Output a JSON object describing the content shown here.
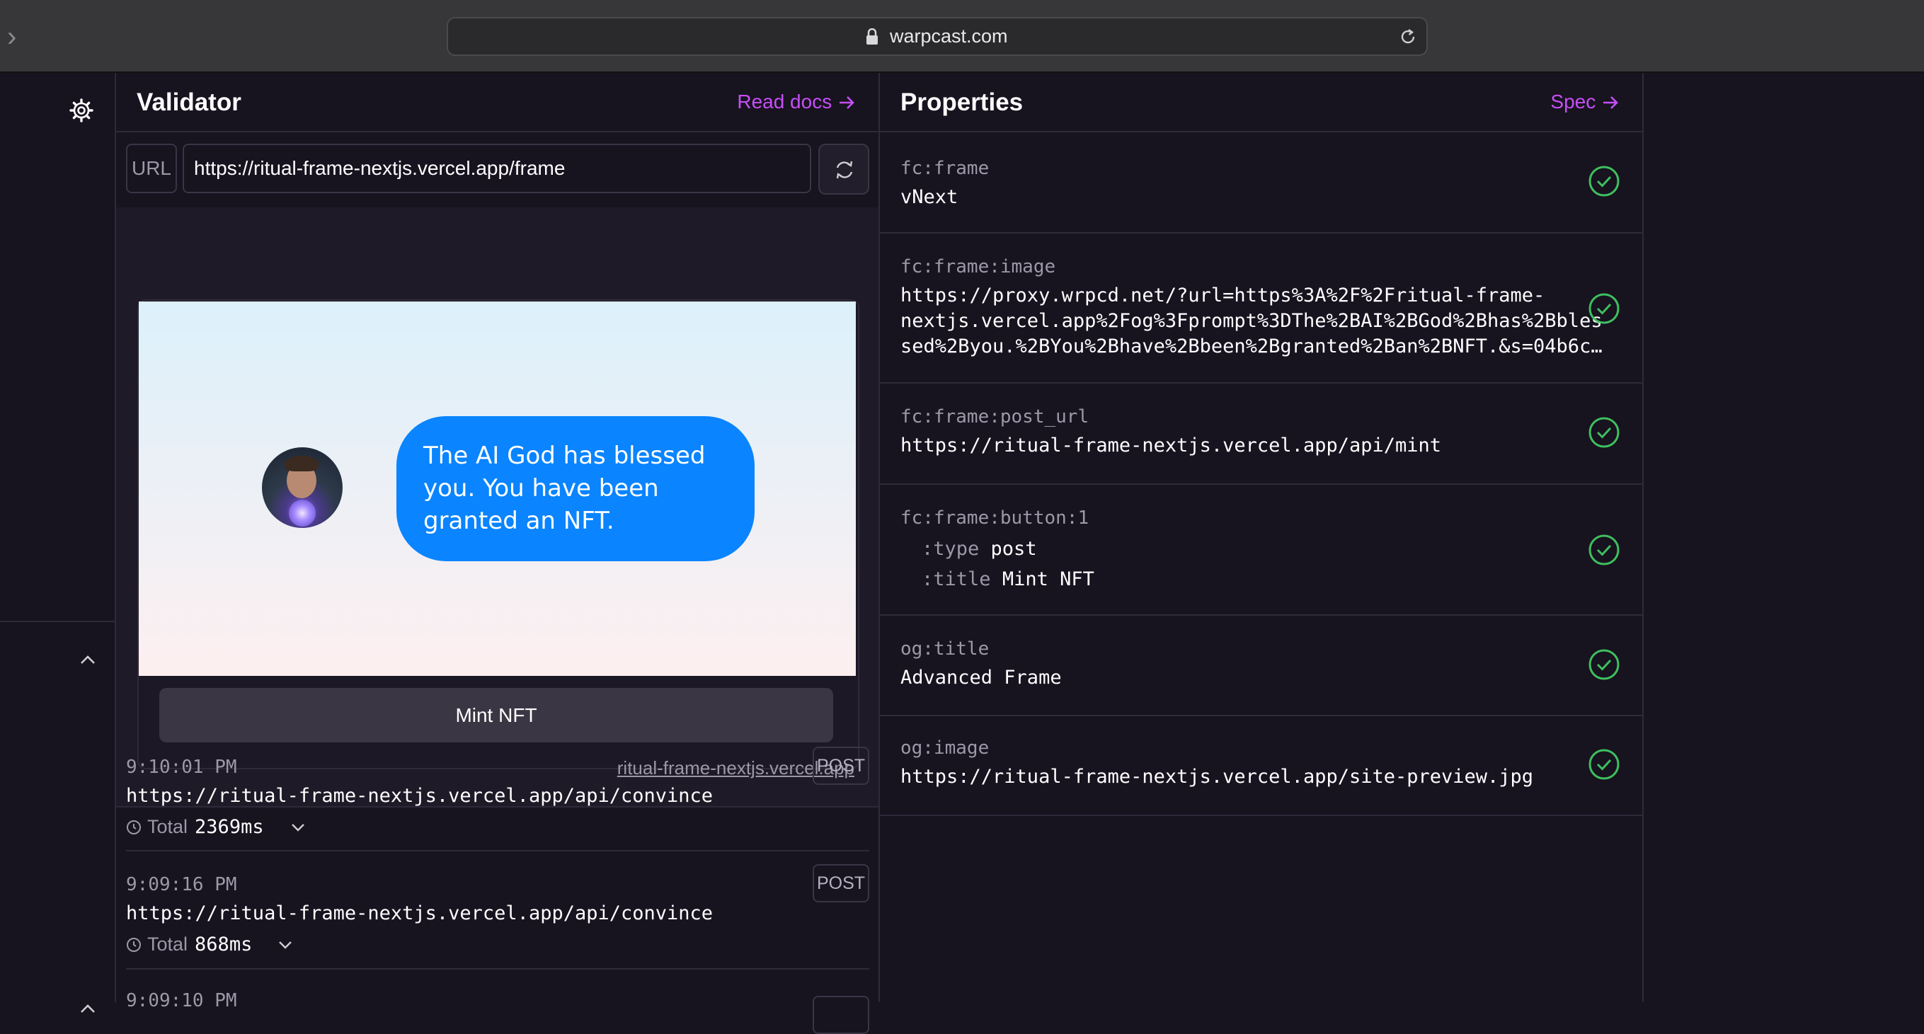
{
  "browser": {
    "host": "warpcast.com"
  },
  "validator": {
    "title": "Validator",
    "docs_link": "Read docs",
    "url_label": "URL",
    "url_value": "https://ritual-frame-nextjs.vercel.app/frame",
    "frame": {
      "bubble_text": "The AI God has blessed you. You have been granted an NFT.",
      "button_label": "Mint NFT",
      "host_link": "ritual-frame-nextjs.vercel.app"
    },
    "logs": [
      {
        "time": "9:10:01 PM",
        "url": "https://ritual-frame-nextjs.vercel.app/api/convince",
        "total_label": "Total",
        "total_value": "2369ms",
        "method": "POST"
      },
      {
        "time": "9:09:16 PM",
        "url": "https://ritual-frame-nextjs.vercel.app/api/convince",
        "total_label": "Total",
        "total_value": "868ms",
        "method": "POST"
      },
      {
        "time": "9:09:10 PM",
        "url": "",
        "total_label": "",
        "total_value": "",
        "method": ""
      }
    ]
  },
  "properties": {
    "title": "Properties",
    "spec_link": "Spec",
    "items": [
      {
        "key": "fc:frame",
        "value": "vNext"
      },
      {
        "key": "fc:frame:image",
        "value_lines": [
          "https://proxy.wrpcd.net/?url=https%3A%2F%2Fritual-frame-",
          "nextjs.vercel.app%2Fog%3Fprompt%3DThe%2BAI%2BGod%2Bhas%2Bbles",
          "sed%2Byou.%2BYou%2Bhave%2Bbeen%2Bgranted%2Ban%2BNFT.&s=04b6c…"
        ]
      },
      {
        "key": "fc:frame:post_url",
        "value": "https://ritual-frame-nextjs.vercel.app/api/mint"
      },
      {
        "key": "fc:frame:button:1",
        "type_key": ":type",
        "type_value": "post",
        "title_key": ":title",
        "title_value": "Mint NFT"
      },
      {
        "key": "og:title",
        "value": "Advanced Frame"
      },
      {
        "key": "og:image",
        "value": "https://ritual-frame-nextjs.vercel.app/site-preview.jpg"
      }
    ]
  },
  "colors": {
    "accent": "#c64ff5",
    "bubble": "#0a84ff",
    "check": "#3fbf5f",
    "background": "#17131f"
  }
}
